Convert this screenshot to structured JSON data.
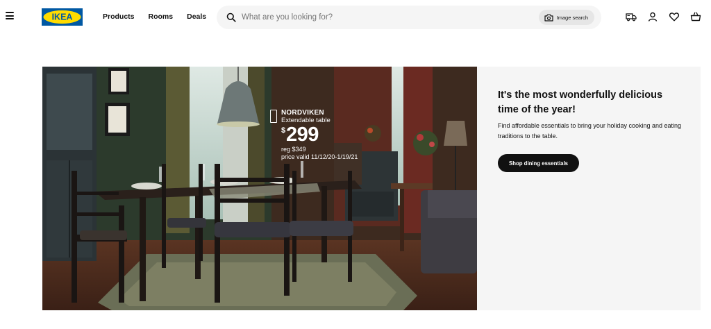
{
  "header": {
    "menu_icon": "hamburger-menu-icon",
    "logo_text": "IKEA",
    "nav": [
      {
        "label": "Products"
      },
      {
        "label": "Rooms"
      },
      {
        "label": "Deals"
      }
    ],
    "search": {
      "placeholder": "What are you looking for?",
      "value": "",
      "icon": "search-icon",
      "image_search_label": "Image search",
      "image_search_icon": "camera-icon"
    },
    "right_icons": [
      "delivery-truck-icon",
      "user-icon",
      "heart-icon",
      "shopping-bag-icon"
    ]
  },
  "hero": {
    "price_tag": {
      "name": "NORDVIKEN",
      "description": "Extendable table",
      "currency": "$",
      "price": "299",
      "reg_price": "reg $349",
      "validity": "price valid 11/12/20-1/19/21"
    },
    "title": "It's the most wonderfully delicious time of the year!",
    "text": "Find affordable essentials to bring your holiday cooking and eating traditions to the table.",
    "button_label": "Shop dining essentials"
  },
  "colors": {
    "ikea_blue": "#0058a3",
    "ikea_yellow": "#ffdb00",
    "panel_bg": "#f5f5f5",
    "button_bg": "#111111"
  }
}
